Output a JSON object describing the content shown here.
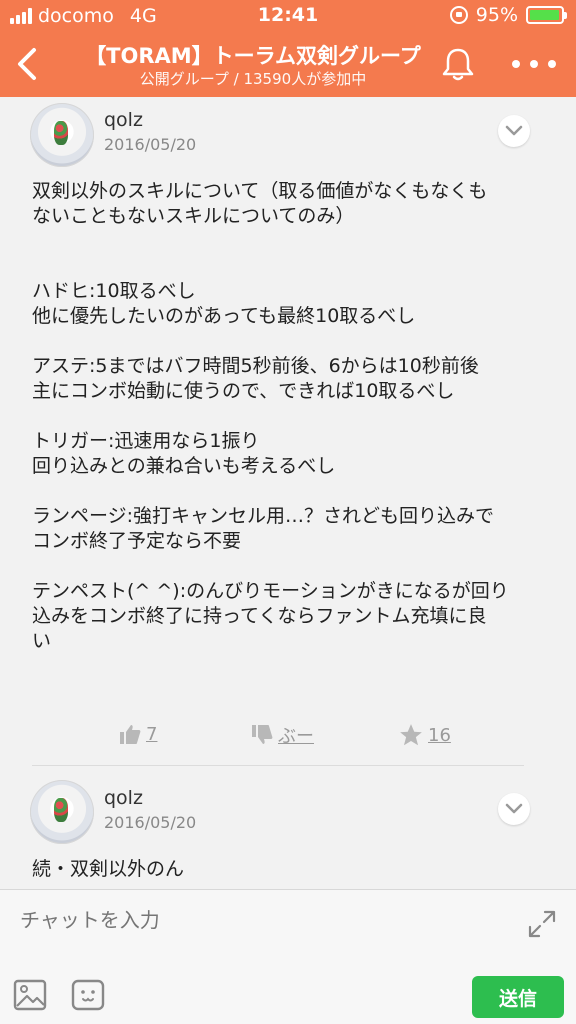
{
  "status_bar": {
    "carrier": "docomo",
    "network": "4G",
    "time": "12:41",
    "battery": "95%",
    "battery_level": 0.95,
    "icons": [
      "signal-icon",
      "orientation-lock-icon",
      "battery-icon"
    ]
  },
  "header": {
    "title": "【TORAM】トーラム双剣グループ",
    "subtitle": "公開グループ / 13590人が参加中",
    "back_icon": "chevron-left-icon",
    "bell_icon": "bell-icon",
    "more_icon": "more-dots-icon"
  },
  "posts": [
    {
      "username": "qolz",
      "date": "2016/05/20",
      "body": "双剣以外のスキルについて（取る価値がなくもなくも\nないこともないスキルについてのみ）\n\n\nハドヒ:10取るべし\n他に優先したいのがあっても最終10取るべし\n\nアステ:5まではバフ時間5秒前後、6からは10秒前後\n主にコンボ始動に使うので、できれば10取るべし\n\nトリガー:迅速用なら1振り\n回り込みとの兼ね合いも考えるべし\n\nランページ:強打キャンセル用…？されども回り込みで\nコンボ終了予定なら不要\n\nテンペスト(^ ^):のんびりモーションがきになるが回り\n込みをコンボ終了に持ってくならファントム充填に良\nい",
      "likes": "7",
      "dislike_label": "ぶー",
      "stars": "16"
    },
    {
      "username": "qolz",
      "date": "2016/05/20",
      "body": "続・双剣以外のん"
    }
  ],
  "composer": {
    "placeholder": "チャットを入力",
    "send_label": "送信",
    "expand_icon": "expand-icon",
    "image_icon": "image-icon",
    "emoji_icon": "emoji-icon"
  },
  "colors": {
    "header_bg": "#f47a4e",
    "send_bg": "#2dbe4f",
    "battery_fill": "#55e04a"
  }
}
